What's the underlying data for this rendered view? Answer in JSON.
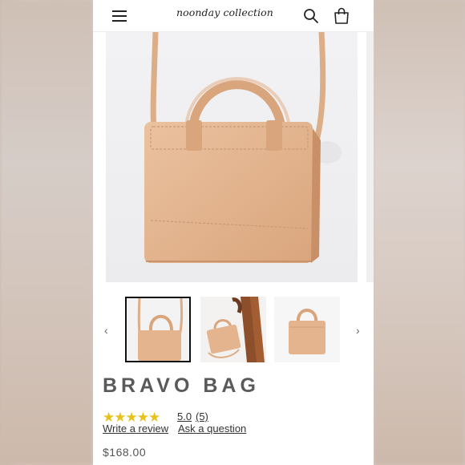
{
  "header": {
    "logo_text": "noonday collection",
    "menu_icon": "hamburger-menu-icon",
    "search_icon": "search-icon",
    "cart_icon": "shopping-bag-icon"
  },
  "gallery": {
    "prev_arrow": "‹",
    "next_arrow": "›",
    "thumbnails": [
      "bag-front-with-strap",
      "bag-carried-model",
      "bag-front-plain"
    ],
    "active_index": 0
  },
  "product": {
    "title": "BRAVO BAG",
    "stars": "★★★★★",
    "rating": "5.0",
    "review_count": "(5)",
    "write_review": "Write a review",
    "ask_question": "Ask a question",
    "price": "$168.00"
  },
  "colors": {
    "leather": "#e3b48e",
    "star": "#e7c21c",
    "title": "#5a5a5a"
  }
}
